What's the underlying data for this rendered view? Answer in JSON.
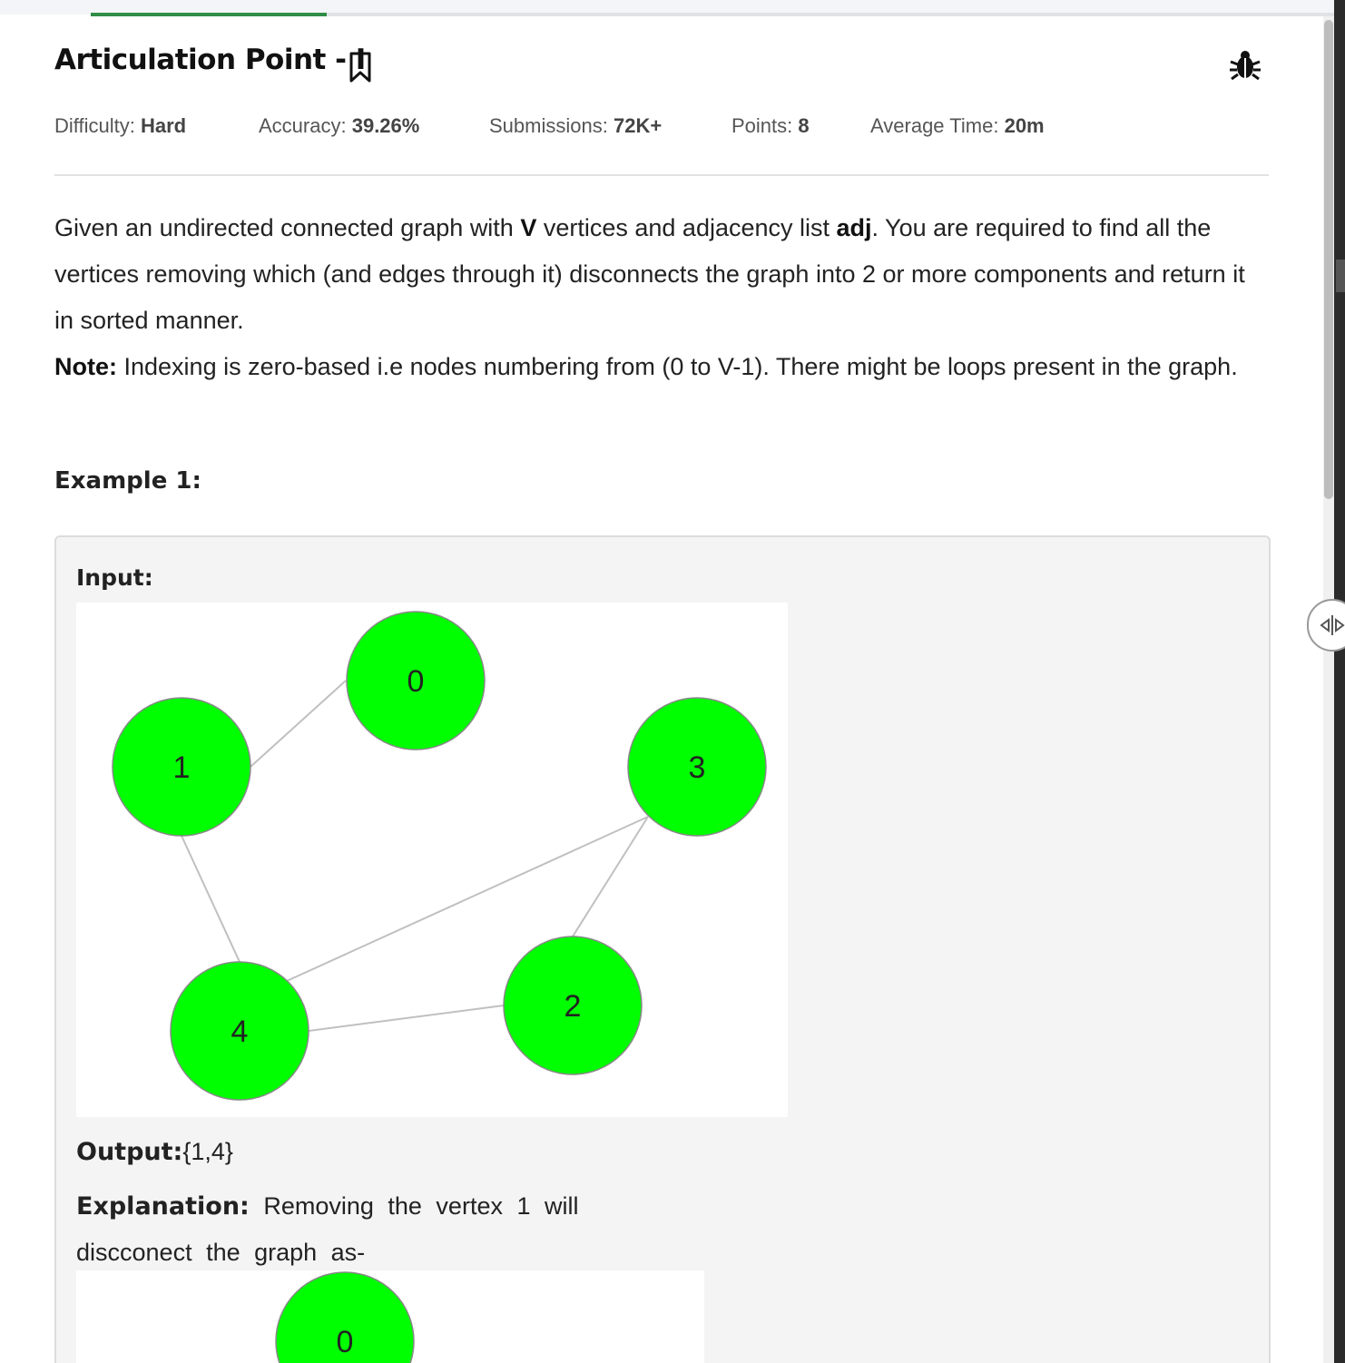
{
  "progress": {
    "percent": 19
  },
  "problem": {
    "title": "Articulation Point - I",
    "meta": {
      "difficulty_label": "Difficulty:",
      "difficulty": "Hard",
      "accuracy_label": "Accuracy:",
      "accuracy": "39.26%",
      "submissions_label": "Submissions:",
      "submissions": "72K+",
      "points_label": "Points:",
      "points": "8",
      "avgtime_label": "Average Time:",
      "avgtime": "20m"
    },
    "description": {
      "p1_a": "Given an undirected connected graph with ",
      "p1_V": "V",
      "p1_b": " vertices and adjacency list ",
      "p1_adj": "adj",
      "p1_c": ". You are required to find all the vertices removing which (and edges through it) disconnects the graph into 2 or more components and return it in sorted manner.",
      "note_label": "Note:",
      "note_text": " Indexing is zero-based i.e nodes numbering from (0 to V-1). There might be loops present in the graph."
    },
    "example": {
      "heading": "Example 1:",
      "input_label": "Input:",
      "output_label": "Output:",
      "output_value": "{1,4}",
      "explanation_label": "Explanation:",
      "explanation_text": " Removing the vertex 1 will discconect the graph as-"
    }
  },
  "graph": {
    "node_color": "#00ff00",
    "nodes": [
      "0",
      "1",
      "2",
      "3",
      "4"
    ],
    "edges": [
      [
        "1",
        "0"
      ],
      [
        "1",
        "4"
      ],
      [
        "4",
        "3"
      ],
      [
        "4",
        "2"
      ],
      [
        "3",
        "2"
      ]
    ]
  },
  "icons": {
    "bookmark": "bookmark-icon",
    "bug": "bug-icon",
    "splitter": "split-handle-icon"
  }
}
